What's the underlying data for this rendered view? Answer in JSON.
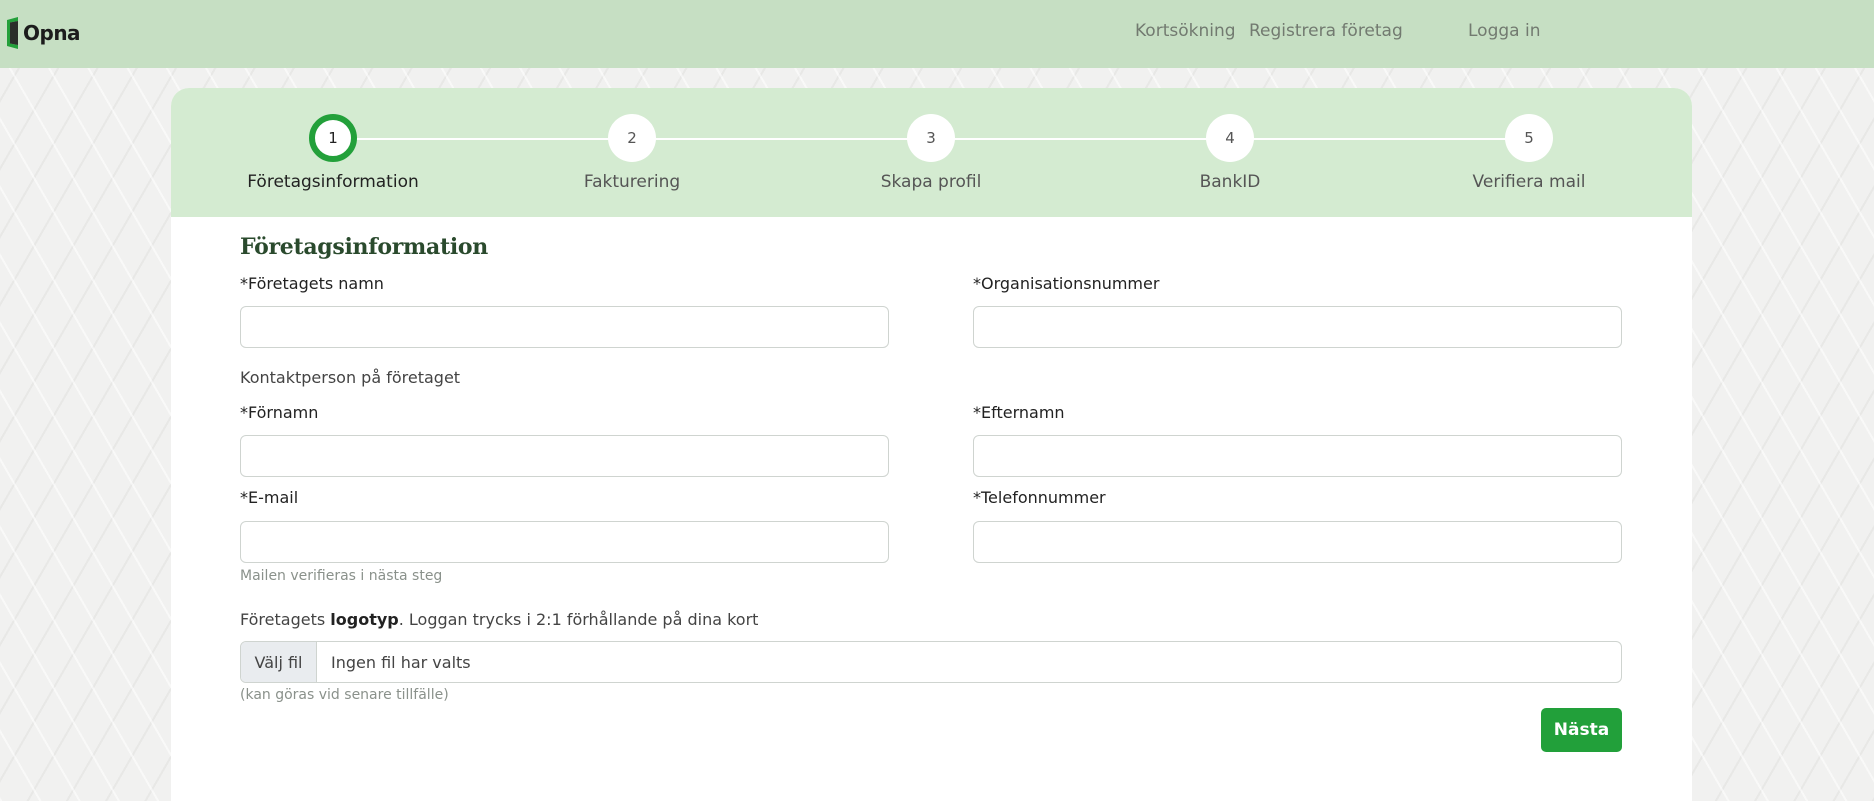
{
  "brand": {
    "name": "Opna",
    "color": "#23a03a"
  },
  "nav": {
    "card_search": "Kortsökning",
    "register_company": "Registrera företag",
    "login": "Logga in"
  },
  "steps": [
    {
      "number": "1",
      "label": "Företagsinformation",
      "active": true
    },
    {
      "number": "2",
      "label": "Fakturering",
      "active": false
    },
    {
      "number": "3",
      "label": "Skapa profil",
      "active": false
    },
    {
      "number": "4",
      "label": "BankID",
      "active": false
    },
    {
      "number": "5",
      "label": "Verifiera mail",
      "active": false
    }
  ],
  "form": {
    "title": "Företagsinformation",
    "company_name_label": "*Företagets namn",
    "org_number_label": "*Organisationsnummer",
    "contact_heading": "Kontaktperson på företaget",
    "first_name_label": "*Förnamn",
    "last_name_label": "*Efternamn",
    "email_label": "*E-mail",
    "phone_label": "*Telefonnummer",
    "email_help": "Mailen verifieras i nästa steg",
    "logo_label_prefix": "Företagets ",
    "logo_label_bold": "logotyp",
    "logo_label_suffix": ". Loggan trycks i 2:1 förhållande på dina kort",
    "file_button": "Välj fil",
    "file_status": "Ingen fil har valts",
    "logo_help": "(kan göras vid senare tillfälle)",
    "values": {
      "company_name": "",
      "org_number": "",
      "first_name": "",
      "last_name": "",
      "email": "",
      "phone": ""
    },
    "next_button": "Nästa"
  },
  "colors": {
    "header_bg": "#c6dfc3",
    "stepper_bg": "#d4ebd1",
    "accent": "#22a03a",
    "title_color": "#2a4a2d"
  }
}
